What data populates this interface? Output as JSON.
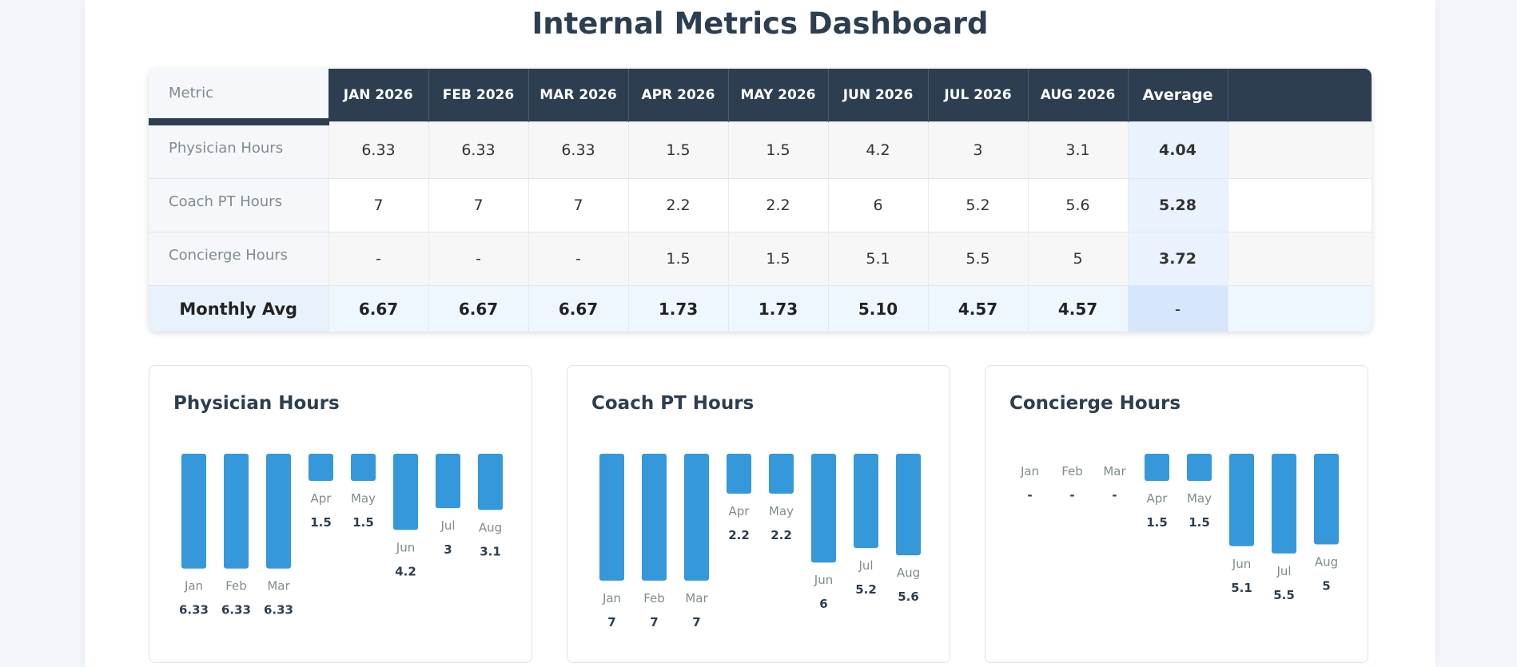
{
  "title": "Internal Metrics Dashboard",
  "table": {
    "metric_header": "Metric",
    "months": [
      "JAN 2026",
      "FEB 2026",
      "MAR 2026",
      "APR 2026",
      "MAY 2026",
      "JUN 2026",
      "JUL 2026",
      "AUG 2026"
    ],
    "average_header": "Average",
    "rows": [
      {
        "label": "Physician Hours",
        "values": [
          "6.33",
          "6.33",
          "6.33",
          "1.5",
          "1.5",
          "4.2",
          "3",
          "3.1"
        ],
        "average": "4.04"
      },
      {
        "label": "Coach PT Hours",
        "values": [
          "7",
          "7",
          "7",
          "2.2",
          "2.2",
          "6",
          "5.2",
          "5.6"
        ],
        "average": "5.28"
      },
      {
        "label": "Concierge Hours",
        "values": [
          "-",
          "-",
          "-",
          "1.5",
          "1.5",
          "5.1",
          "5.5",
          "5"
        ],
        "average": "3.72"
      }
    ],
    "footer": {
      "label": "Monthly Avg",
      "values": [
        "6.67",
        "6.67",
        "6.67",
        "1.73",
        "1.73",
        "5.10",
        "4.57",
        "4.57"
      ],
      "average": "-"
    }
  },
  "chart_data": [
    {
      "type": "bar",
      "title": "Physician Hours",
      "categories": [
        "Jan",
        "Feb",
        "Mar",
        "Apr",
        "May",
        "Jun",
        "Jul",
        "Aug"
      ],
      "values": [
        6.33,
        6.33,
        6.33,
        1.5,
        1.5,
        4.2,
        3,
        3.1
      ],
      "value_labels": [
        "6.33",
        "6.33",
        "6.33",
        "1.5",
        "1.5",
        "4.2",
        "3",
        "3.1"
      ],
      "color": "#3498db"
    },
    {
      "type": "bar",
      "title": "Coach PT Hours",
      "categories": [
        "Jan",
        "Feb",
        "Mar",
        "Apr",
        "May",
        "Jun",
        "Jul",
        "Aug"
      ],
      "values": [
        7,
        7,
        7,
        2.2,
        2.2,
        6,
        5.2,
        5.6
      ],
      "value_labels": [
        "7",
        "7",
        "7",
        "2.2",
        "2.2",
        "6",
        "5.2",
        "5.6"
      ],
      "color": "#3498db"
    },
    {
      "type": "bar",
      "title": "Concierge Hours",
      "categories": [
        "Jan",
        "Feb",
        "Mar",
        "Apr",
        "May",
        "Jun",
        "Jul",
        "Aug"
      ],
      "values": [
        null,
        null,
        null,
        1.5,
        1.5,
        5.1,
        5.5,
        5
      ],
      "value_labels": [
        "-",
        "-",
        "-",
        "1.5",
        "1.5",
        "5.1",
        "5.5",
        "5"
      ],
      "color": "#3498db"
    }
  ]
}
